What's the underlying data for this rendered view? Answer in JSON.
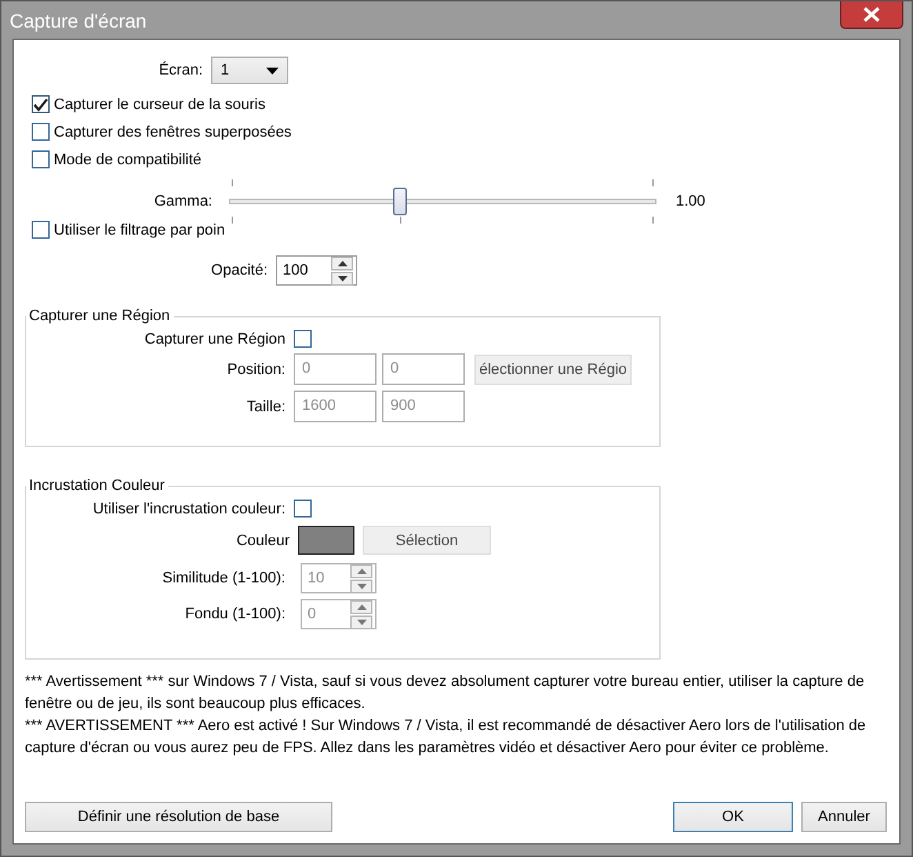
{
  "window": {
    "title": "Capture d'écran"
  },
  "screen": {
    "label": "Écran:",
    "value": "1"
  },
  "checkboxes": [
    {
      "label": "Capturer le curseur de la souris",
      "checked": true
    },
    {
      "label": "Capturer des fenêtres superposées",
      "checked": false
    },
    {
      "label": "Mode de compatibilité",
      "checked": false
    }
  ],
  "gamma": {
    "label": "Gamma:",
    "level": 0.4,
    "reading": "1.00"
  },
  "point_filter": {
    "label": "Utiliser le filtrage par poin",
    "checked": false
  },
  "opacity": {
    "label": "Opacité:",
    "value": "100"
  },
  "region": {
    "title": "Capturer une Région",
    "enable": {
      "label": "Capturer une Région",
      "checked": false
    },
    "position": {
      "label": "Position:",
      "values": [
        "0",
        "0"
      ],
      "disabled": true
    },
    "select_button": "électionner une Régio",
    "size": {
      "label": "Taille:",
      "values": [
        "1600",
        "900"
      ],
      "disabled": true
    }
  },
  "color_key": {
    "title": "Incrustation Couleur",
    "enable": {
      "label": "Utiliser l'incrustation couleur:",
      "checked": false
    },
    "color_label": "Couleur",
    "color": "#808080",
    "select_button": "Sélection",
    "similarity": {
      "label": "Similitude (1-100):",
      "value": "10",
      "disabled": true
    },
    "blend": {
      "label": "Fondu (1-100):",
      "value": "0",
      "disabled": true
    }
  },
  "warnings": [
    "*** Avertissement *** sur Windows 7 / Vista, sauf si vous devez absolument capturer votre bureau entier, utiliser la capture de fenêtre ou de jeu, ils sont beaucoup plus efficaces.",
    "*** AVERTISSEMENT *** Aero est activé !  Sur Windows 7 / Vista, il est recommandé de désactiver Aero lors de l'utilisation de capture d'écran ou vous aurez peu de FPS.  Allez dans les paramètres vidéo et désactiver Aero pour éviter ce problème."
  ],
  "buttons": {
    "base_resolution": "Définir une résolution de base",
    "ok": "OK",
    "cancel": "Annuler"
  }
}
